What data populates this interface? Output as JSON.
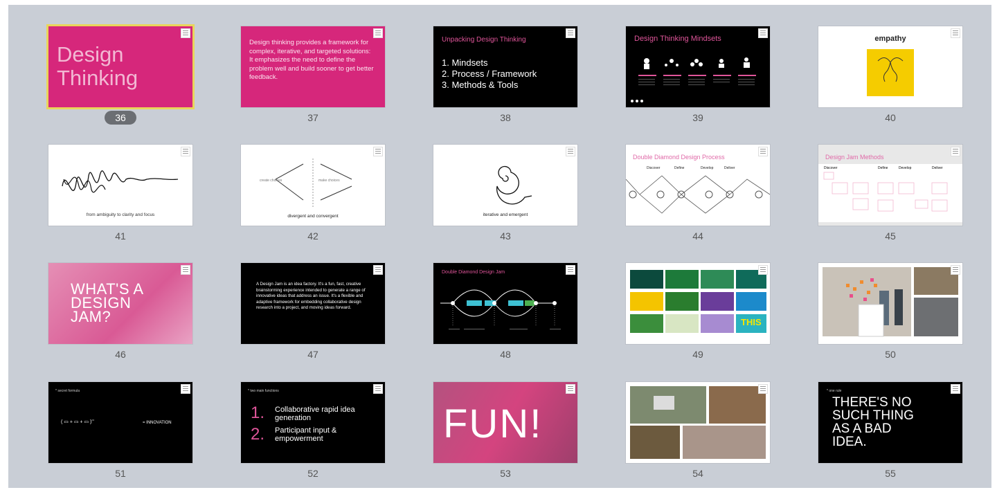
{
  "slides": [
    {
      "number": "36",
      "title_line1": "Design",
      "title_line2": "Thinking",
      "selected": true
    },
    {
      "number": "37",
      "text": "Design thinking provides a framework for complex, iterative, and targeted solutions: It emphasizes the need to define the problem well and build sooner to get better feedback."
    },
    {
      "number": "38",
      "title": "Unpacking Design Thinking",
      "items": [
        "1. Mindsets",
        "2. Process / Framework",
        "3. Methods & Tools"
      ]
    },
    {
      "number": "39",
      "title": "Design Thinking Mindsets"
    },
    {
      "number": "40",
      "title": "empathy"
    },
    {
      "number": "41",
      "caption": "from ambiguity to clarity and focus"
    },
    {
      "number": "42",
      "caption": "divergent and convergent",
      "left_label": "create choices",
      "right_label": "make choices"
    },
    {
      "number": "43",
      "caption": "iterative and emergent"
    },
    {
      "number": "44",
      "title": "Double Diamond Design Process",
      "phases": [
        "Discover",
        "Define",
        "Develop",
        "Deliver"
      ]
    },
    {
      "number": "45",
      "title": "Design Jam Methods",
      "phases": [
        "Discover",
        "Define",
        "Develop",
        "Deliver"
      ]
    },
    {
      "number": "46",
      "title_lines": [
        "WHAT'S A",
        "DESIGN",
        "JAM?"
      ]
    },
    {
      "number": "47",
      "text": "A Design Jam is an idea factory. It's a fun, fast, creative brainstorming experience intended to generate a range of innovative ideas that address an issue. It's a flexible and adaptive framework for embedding collaborative design research into a project, and moving ideas forward."
    },
    {
      "number": "48",
      "title": "Double Diamond Design Jam"
    },
    {
      "number": "49",
      "tile_labels": [
        "THIS"
      ]
    },
    {
      "number": "50"
    },
    {
      "number": "51",
      "label": "* secret formula",
      "formula_result": "= INNOVATION"
    },
    {
      "number": "52",
      "label": "* two main functions",
      "items": [
        {
          "n": "1.",
          "text": "Collaborative rapid idea generation"
        },
        {
          "n": "2.",
          "text": "Participant input & empowerment"
        }
      ]
    },
    {
      "number": "53",
      "title": "FUN!"
    },
    {
      "number": "54"
    },
    {
      "number": "55",
      "label": "* one rule",
      "title_lines": [
        "THERE'S NO",
        "SUCH THING",
        "AS A BAD",
        "IDEA."
      ]
    }
  ],
  "colors": {
    "background": "#c9ced6",
    "pink": "#d6277b",
    "yellow": "#f5cc00",
    "selection": "#e9d55a"
  }
}
